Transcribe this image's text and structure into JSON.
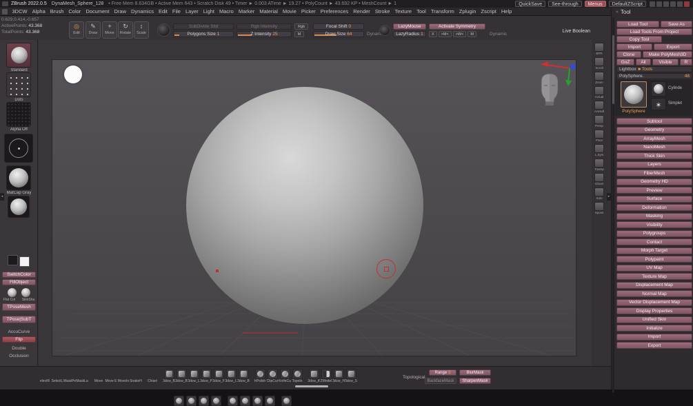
{
  "colors": {
    "accent": "#e09a57",
    "button": "#8c5f6d",
    "cursor_red": "#c43030"
  },
  "titlebar": {
    "app_title": "ZBrush 2022.0.5",
    "doc_title": "DynaMesh_Sphere_128",
    "stats": "• Free Mem 8.634GB • Active Mem 643 • Scratch Disk 49 • Timer ► 0.003 ATime ► 19.27 • PolyCount ► 43.692 KP • MeshCount ► 1",
    "quicksave": "QuickSave",
    "see_through": "See-through",
    "menus": "Menus",
    "default_zscript": "DefaultZScript"
  },
  "menubar": {
    "items": [
      "3DCW",
      "Alpha",
      "Brush",
      "Color",
      "Document",
      "Draw",
      "Dynamics",
      "Edit",
      "File",
      "Layer",
      "Light",
      "Macro",
      "Marker",
      "Material",
      "Movie",
      "Picker",
      "Preferences",
      "Render",
      "Stroke",
      "Texture",
      "Tool",
      "Transform",
      "Zplugin",
      "Zscript",
      "Help"
    ]
  },
  "stats": {
    "coords": "0.629,0.414,-0.657",
    "active_label": "ActivePoints:",
    "active_value": "43.368",
    "total_label": "TotalPoints:",
    "total_value": "43.368"
  },
  "topshelf": {
    "edit": "Edit",
    "draw": "Draw",
    "move": "Move",
    "rotate": "Rotate",
    "scale": "Scale",
    "subdivide": "SubDivide Slid",
    "rgb_intensity": "Rgb Intensity",
    "polygons_size": "Polygons Size",
    "polygons_size_value": "1",
    "z_intensity": "Z Intensity",
    "z_intensity_value": "25",
    "rgb": "Rgb",
    "m": "M",
    "focal_shift": "Focal Shift",
    "focal_shift_value": "0",
    "draw_size": "Draw Size",
    "draw_size_value": "64",
    "dynamic": "Dynamic",
    "lazymouse": "LazyMouse",
    "lazyradius": "LazyRadius",
    "lazyradius_value": "1",
    "activate_symmetry": "Activate Symmetry",
    "sym_buttons": [
      "X",
      ">M<",
      ">W<",
      "M"
    ],
    "dynamic2": "Dynamic",
    "live_boolean": "Live Boolean"
  },
  "leftshelf": {
    "brush": "Standard",
    "stroke": "Dots",
    "alpha": "Alpha Off",
    "material": "MatCap Gray",
    "switch_color": "SwitchColor",
    "fill_object": "FillObject",
    "swatch1": "Flat Col",
    "swatch2": "SkinSha",
    "tpose_mesh": "TPoseMesh",
    "tpose_subt": "TPose|SubT",
    "accucurve": "AccuCurve",
    "flip": "Flip",
    "double": "Double",
    "occlusion": "Occlusion"
  },
  "rightshelf": {
    "items": [
      "BPR",
      "Scroll",
      "Zoom",
      "Actual",
      "AAHalf",
      "Persp",
      "Floor",
      "L.Sym",
      "Transp",
      "Ghost",
      "Solo",
      "Xpose"
    ]
  },
  "toolpanel": {
    "title": "Tool",
    "load_tool": "Load Tool",
    "save_as": "Save As",
    "load_from_project": "Load Tools From Project",
    "copy_tool": "Copy Tool",
    "import": "Import",
    "export": "Export",
    "clone": "Clone",
    "make_polymesh": "Make PolyMesh3D",
    "goz": "GoZ",
    "all": "All",
    "visible": "Visible",
    "r": "R",
    "lightbox_label": "Lightbox",
    "lightbox_arrow": "►Tools",
    "active_tool": "PolySphere.",
    "active_tool_value": "48",
    "current_label": "PolySphere",
    "thumb_cylinder": "Cylinde",
    "thumb_simplet": "Simplet",
    "sections": [
      "Subtool",
      "Geometry",
      "ArrayMesh",
      "NanoMesh",
      "Thick Skin",
      "Layers",
      "FiberMesh",
      "Geometry HD",
      "Preview",
      "Surface",
      "Deformation",
      "Masking",
      "Visibility",
      "Polygroups",
      "Contact",
      "Morph Target",
      "Polypaint",
      "UV Map",
      "Texture Map",
      "Displacement Map",
      "Normal Map",
      "Vector Displacement Map",
      "Display Properties",
      "Unified Skin",
      "Initialize",
      "Import",
      "Export"
    ]
  },
  "bottomshelf": {
    "tools": [
      {
        "label": "electR",
        "icon": "sphere",
        "gap": ""
      },
      {
        "label": "SelectL",
        "icon": "sphere",
        "gap": ""
      },
      {
        "label": "MaskPe",
        "icon": "sphere",
        "gap": ""
      },
      {
        "label": "MaskLa",
        "icon": "sphere",
        "gap": "gap"
      },
      {
        "label": "Move",
        "icon": "sphere",
        "gap": ""
      },
      {
        "label": "Move E",
        "icon": "sphere",
        "gap": ""
      },
      {
        "label": "MoveIn",
        "icon": "sphere",
        "gap": ""
      },
      {
        "label": "SnakeH",
        "icon": "sphere",
        "gap": "gap"
      },
      {
        "label": "Chisel",
        "icon": "sphere",
        "gap": "gap"
      },
      {
        "label": "3dcw_B",
        "icon": "cube",
        "gap": ""
      },
      {
        "label": "3dcw_B",
        "icon": "cube",
        "gap": ""
      },
      {
        "label": "3dcw_L",
        "icon": "cube",
        "gap": ""
      },
      {
        "label": "3dcw_P",
        "icon": "cube",
        "gap": ""
      },
      {
        "label": "3dcw_F",
        "icon": "cube",
        "gap": ""
      },
      {
        "label": "3dcw_L",
        "icon": "cube",
        "gap": ""
      },
      {
        "label": "3dcw_B",
        "icon": "cube",
        "gap": "gap"
      },
      {
        "label": "hPolish",
        "icon": "disc",
        "gap": ""
      },
      {
        "label": "ClipCur",
        "icon": "disc",
        "gap": ""
      },
      {
        "label": "KnifeCu",
        "icon": "disc",
        "gap": ""
      },
      {
        "label": "Topolo",
        "icon": "disc",
        "gap": "gap"
      },
      {
        "label": "3dcw_tf",
        "icon": "cube",
        "gap": ""
      },
      {
        "label": "ZModel",
        "icon": "half",
        "gap": ""
      },
      {
        "label": "3dcw_H",
        "icon": "cube",
        "gap": ""
      },
      {
        "label": "3dcw_S",
        "icon": "cube",
        "gap": ""
      }
    ],
    "topological": "Topological",
    "range": "Range",
    "range_value": "5",
    "blurmask": "BlurMask",
    "backfacemask": "BackfaceMask",
    "sharpenmask": "SharpenMask"
  }
}
